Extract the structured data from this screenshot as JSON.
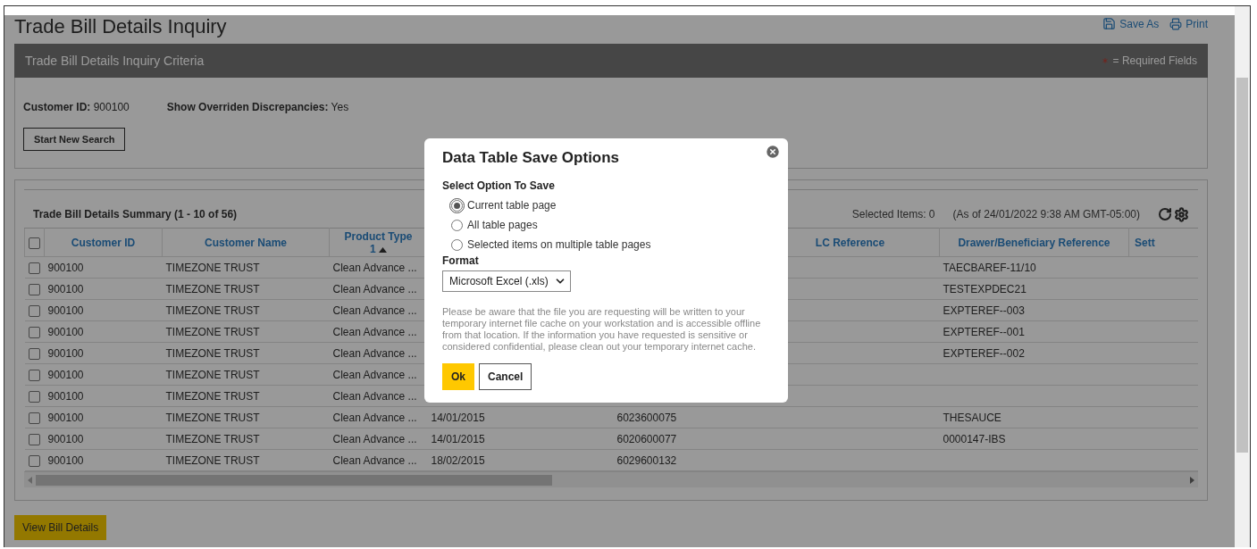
{
  "page": {
    "title": "Trade Bill Details Inquiry",
    "actions": [
      {
        "label": "Save As",
        "kind": "save"
      },
      {
        "label": "Print",
        "kind": "print"
      }
    ]
  },
  "criteria": {
    "title": "Trade Bill Details Inquiry Criteria",
    "required_note": "= Required Fields",
    "fields": [
      {
        "label": "Customer ID:",
        "value": "900100"
      },
      {
        "label": "Show Overriden Discrepancies:",
        "value": "Yes"
      }
    ],
    "button": "Start New Search"
  },
  "summary": {
    "title": "Trade Bill Details Summary (1 - 10 of 56)",
    "selected_items": "Selected Items: 0",
    "as_of": "(As of 24/01/2022 9:38 AM GMT-05:00)",
    "select_all_checked": false,
    "columns": [
      {
        "label": "Customer ID"
      },
      {
        "label": "Customer Name"
      },
      {
        "label": "Product Type",
        "sort_order": "1"
      },
      {},
      {},
      {
        "label": "LC Reference"
      },
      {
        "label": "Drawer/Beneficiary Reference"
      },
      {
        "label": "Sett"
      }
    ],
    "rows": [
      {
        "checked": false,
        "customer_id": "900100",
        "customer_name": "TIMEZONE TRUST",
        "product_type": "Clean Advance ...",
        "drawer_reference": "TAECBAREF-11/10"
      },
      {
        "checked": false,
        "customer_id": "900100",
        "customer_name": "TIMEZONE TRUST",
        "product_type": "Clean Advance ...",
        "drawer_reference": "TESTEXPDEC21"
      },
      {
        "checked": false,
        "customer_id": "900100",
        "customer_name": "TIMEZONE TRUST",
        "product_type": "Clean Advance ...",
        "drawer_reference": "EXPTEREF--003"
      },
      {
        "checked": false,
        "customer_id": "900100",
        "customer_name": "TIMEZONE TRUST",
        "product_type": "Clean Advance ...",
        "drawer_reference": "EXPTEREF--001"
      },
      {
        "checked": false,
        "customer_id": "900100",
        "customer_name": "TIMEZONE TRUST",
        "product_type": "Clean Advance ...",
        "drawer_reference": "EXPTEREF--002"
      },
      {
        "checked": false,
        "customer_id": "900100",
        "customer_name": "TIMEZONE TRUST",
        "product_type": "Clean Advance ..."
      },
      {
        "checked": false,
        "customer_id": "900100",
        "customer_name": "TIMEZONE TRUST",
        "product_type": "Clean Advance ..."
      },
      {
        "checked": false,
        "customer_id": "900100",
        "customer_name": "TIMEZONE TRUST",
        "product_type": "Clean Advance ...",
        "column_4": "14/01/2015",
        "column_5": "6023600075",
        "drawer_reference": "THESAUCE"
      },
      {
        "checked": false,
        "customer_id": "900100",
        "customer_name": "TIMEZONE TRUST",
        "product_type": "Clean Advance ...",
        "column_4": "14/01/2015",
        "column_5": "6020600077",
        "drawer_reference": "0000147-IBS"
      },
      {
        "checked": false,
        "customer_id": "900100",
        "customer_name": "TIMEZONE TRUST",
        "product_type": "Clean Advance ...",
        "column_4": "18/02/2015",
        "column_5": "6029600132"
      }
    ]
  },
  "footer_button": "View Bill Details",
  "dialog": {
    "title": "Data Table Save Options",
    "options_label": "Select Option To Save",
    "options": [
      {
        "label": "Current table page",
        "selected": true
      },
      {
        "label": "All table pages",
        "selected": false
      },
      {
        "label": "Selected items on multiple table pages",
        "selected": false
      }
    ],
    "format_label": "Format",
    "format_value": "Microsoft Excel (.xls)",
    "notice": "Please be aware that the file you are requesting will be written to your temporary internet file cache on your workstation and is accessible offline from that location. If the information you have requested is sensitive or considered confidential, please clean out your temporary internet cache.",
    "buttons": [
      {
        "label": "Ok",
        "kind": "primary"
      },
      {
        "label": "Cancel",
        "kind": "secondary"
      }
    ]
  }
}
